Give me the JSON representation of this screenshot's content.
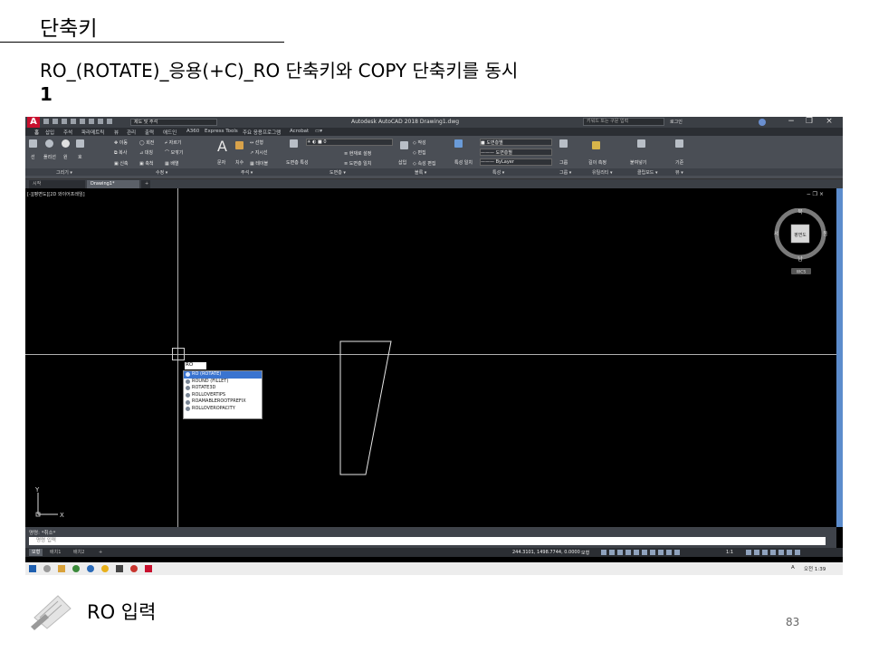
{
  "slide": {
    "title": "단축키",
    "heading": "RO_(ROTATE)_응용(+C)_RO 단축키와 COPY 단축키를 동시",
    "heading_number": "1",
    "caption": "RO 입력",
    "page_number": "83"
  },
  "app": {
    "logo": "A",
    "workspace": "제도 및 주석",
    "title": "Autodesk AutoCAD 2018   Drawing1.dwg",
    "search_placeholder": "키워드 또는 구문 입력",
    "sign_in": "로그인",
    "window_controls": [
      "−",
      "❐",
      "×"
    ]
  },
  "menu_tabs": [
    "홈",
    "삽입",
    "주석",
    "파라메트릭",
    "뷰",
    "관리",
    "출력",
    "애드인",
    "A360",
    "Express Tools",
    "주요 응용프로그램",
    "Acrobat",
    "▭▾"
  ],
  "ribbon_panels": [
    "그리기 ▾",
    "수정 ▾",
    "주석 ▾",
    "도면층 ▾",
    "블록 ▾",
    "특성 ▾",
    "그룹 ▾",
    "유틸리티 ▾",
    "클립보드 ▾",
    "뷰 ▾"
  ],
  "ribbon_items": {
    "line": "선",
    "polyline": "폴리선",
    "circle": "원",
    "arc": "호",
    "move": "이동",
    "rotate": "회전",
    "trim": "자르기",
    "copy": "복사",
    "mirror": "대칭",
    "fillet": "모깎기",
    "stretch": "신축",
    "scale": "축척",
    "array": "배열",
    "text": "문자",
    "dimension": "치수",
    "linear": "선형",
    "leader": "지시선",
    "table": "테이블",
    "layer_props": "도면층 특성",
    "make_current": "현재로 설정",
    "match_layer": "도면층 일치",
    "insert": "삽입",
    "create": "작성",
    "edit": "편집",
    "edit_attr": "속성 편집",
    "match_props": "특성 일치",
    "bylayer": "ByLayer",
    "color": "도면층별",
    "group": "그룹",
    "measure": "길이 측정",
    "paste": "붙여넣기",
    "base": "기준"
  },
  "document_tabs": [
    "시작",
    "Drawing1*",
    "+"
  ],
  "viewport": {
    "label": "[-][평면도][2D 와이어프레임]",
    "controls": "− ❐ ×"
  },
  "command": {
    "typed": "RO",
    "autocomplete": [
      {
        "label": "RO (ROTATE)",
        "selected": true
      },
      {
        "label": "ROUND (FILLET)",
        "selected": false
      },
      {
        "label": "ROTATE3D",
        "selected": false
      },
      {
        "label": "ROLLOVERTIPS",
        "selected": false
      },
      {
        "label": "ROAMABLEROOTPREFIX",
        "selected": false
      },
      {
        "label": "ROLLOVEROPACITY",
        "selected": false
      }
    ],
    "history": "명령: *취소*",
    "prompt_placeholder": "명령 입력"
  },
  "viewcube": {
    "north": "북",
    "south": "남",
    "east": "동",
    "west": "서",
    "face": "평면도",
    "wcs": "WCS"
  },
  "ucs": {
    "x": "X",
    "y": "Y"
  },
  "layout_tabs": [
    "모형",
    "배치1",
    "배치2",
    "+"
  ],
  "status": {
    "coordinates": "244.3101, 1498.7744, 0.0000",
    "model": "모형",
    "scale": "1:1"
  },
  "taskbar": {
    "time": "오전 1:39",
    "ime": "A"
  },
  "colors": {
    "autocad_red": "#c8102e",
    "selection_blue": "#3a74d0",
    "ribbon_gray": "#4a4e55"
  }
}
